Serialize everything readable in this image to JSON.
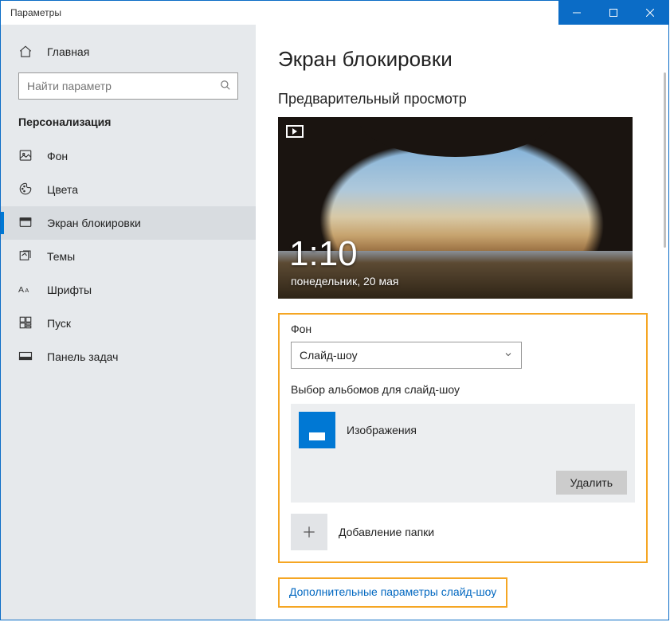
{
  "titlebar": {
    "title": "Параметры"
  },
  "sidebar": {
    "home": "Главная",
    "search_placeholder": "Найти параметр",
    "section": "Персонализация",
    "items": [
      {
        "label": "Фон"
      },
      {
        "label": "Цвета"
      },
      {
        "label": "Экран блокировки"
      },
      {
        "label": "Темы"
      },
      {
        "label": "Шрифты"
      },
      {
        "label": "Пуск"
      },
      {
        "label": "Панель задач"
      }
    ]
  },
  "content": {
    "title": "Экран блокировки",
    "preview_heading": "Предварительный просмотр",
    "preview": {
      "time": "1:10",
      "date": "понедельник, 20 мая"
    },
    "background_label": "Фон",
    "background_value": "Слайд-шоу",
    "albums_label": "Выбор альбомов для слайд-шоу",
    "album": {
      "name": "Изображения",
      "delete": "Удалить"
    },
    "add_folder": "Добавление папки",
    "advanced_link": "Дополнительные параметры слайд-шоу"
  }
}
